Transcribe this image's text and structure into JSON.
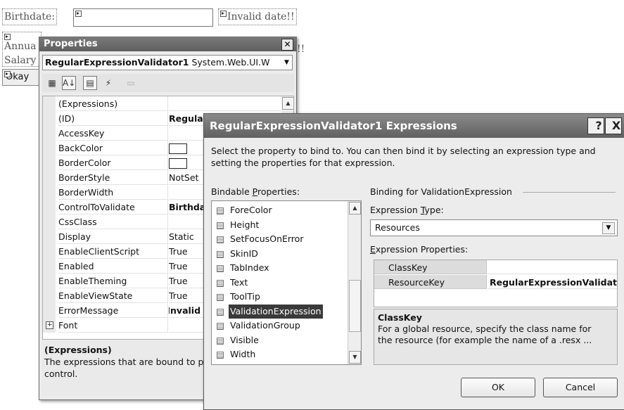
{
  "designer": {
    "birthdate_label": "Birthdate:",
    "invalid_date_text": "Invalid date!!",
    "annual_label_partial": "Annua",
    "salary_label_partial": "Salary",
    "exclam_partial": "!!",
    "okay_button_partial": "Okay"
  },
  "properties": {
    "title": "Properties",
    "object_name": "RegularExpressionValidator1",
    "object_type": "System.Web.UI.W",
    "rows": [
      {
        "name": "(Expressions)",
        "value": ""
      },
      {
        "name": "(ID)",
        "value": "Regula",
        "bold": true
      },
      {
        "name": "AccessKey",
        "value": ""
      },
      {
        "name": "BackColor",
        "value": "",
        "swatch": true
      },
      {
        "name": "BorderColor",
        "value": "",
        "swatch": true
      },
      {
        "name": "BorderStyle",
        "value": "NotSet"
      },
      {
        "name": "BorderWidth",
        "value": ""
      },
      {
        "name": "ControlToValidate",
        "value": "Birthda",
        "bold": true
      },
      {
        "name": "CssClass",
        "value": ""
      },
      {
        "name": "Display",
        "value": "Static"
      },
      {
        "name": "EnableClientScript",
        "value": "True"
      },
      {
        "name": "Enabled",
        "value": "True"
      },
      {
        "name": "EnableTheming",
        "value": "True"
      },
      {
        "name": "EnableViewState",
        "value": "True"
      },
      {
        "name": "ErrorMessage",
        "value": "Invalid",
        "bold": true
      },
      {
        "name": "Font",
        "value": ""
      }
    ],
    "desc_title": "(Expressions)",
    "desc_text_1": "The expressions that are bound to p",
    "desc_text_2": "control."
  },
  "dialog": {
    "title": "RegularExpressionValidator1 Expressions",
    "help_label": "?",
    "close_label": "X",
    "intro_1": "Select the property to bind to.  You can then bind it by selecting an expression type and",
    "intro_2": "setting the properties for that expression.",
    "bindable_label_pre": "Bindable ",
    "bindable_label_u": "P",
    "bindable_label_post": "roperties:",
    "binding_for_label": "Binding for ValidationExpression",
    "bindable_items": [
      "ForeColor",
      "Height",
      "SetFocusOnError",
      "SkinID",
      "TabIndex",
      "Text",
      "ToolTip",
      "ValidationExpression",
      "ValidationGroup",
      "Visible",
      "Width"
    ],
    "selected_item": "ValidationExpression",
    "expr_type_label_pre": "Expression ",
    "expr_type_label_u": "T",
    "expr_type_label_post": "ype:",
    "expr_type_value": "Resources",
    "expr_props_label_u": "E",
    "expr_props_label_post": "xpression Properties:",
    "expr_props": [
      {
        "name": "ClassKey",
        "value": ""
      },
      {
        "name": "ResourceKey",
        "value": "RegularExpressionValidat"
      }
    ],
    "desc_title": "ClassKey",
    "desc_text_1": "For a global resource, specify the class name for",
    "desc_text_2": "the resource (for example the name of a .resx ...",
    "ok_label": "OK",
    "cancel_label": "Cancel"
  }
}
